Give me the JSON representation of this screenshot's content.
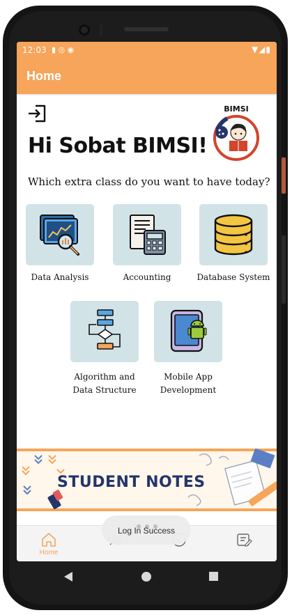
{
  "status_bar": {
    "time": "12:03"
  },
  "app_bar": {
    "title": "Home"
  },
  "logo_text": "BIMSI",
  "greeting": "Hi Sobat BIMSI!",
  "question": "Which extra class do you want to have today?",
  "classes": [
    {
      "label_line1": "Data Analysis",
      "label_line2": ""
    },
    {
      "label_line1": "Accounting",
      "label_line2": ""
    },
    {
      "label_line1": "Database System",
      "label_line2": ""
    },
    {
      "label_line1": "Algorithm and",
      "label_line2": "Data Structure"
    },
    {
      "label_line1": "Mobile App",
      "label_line2": "Development"
    }
  ],
  "banner": {
    "title": "STUDENT NOTES"
  },
  "bottom_nav": {
    "items": [
      {
        "label": "Home"
      }
    ]
  },
  "toast": {
    "message": "Log In Success"
  },
  "colors": {
    "accent": "#f6a55a",
    "card_bg": "#d2e3e8",
    "banner_title": "#25356b"
  }
}
